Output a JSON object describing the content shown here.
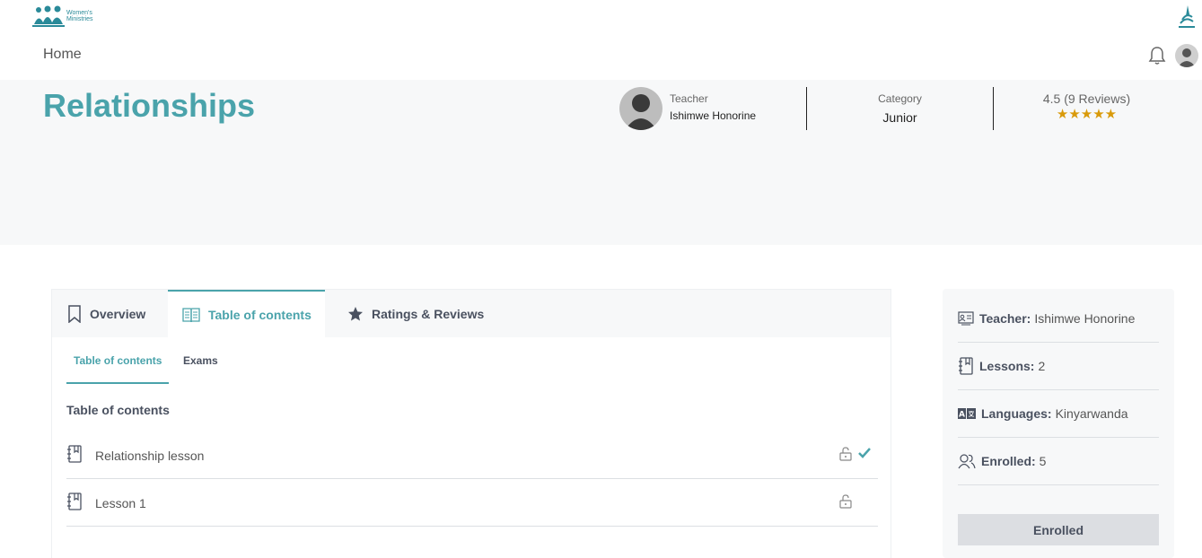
{
  "header": {
    "logo_text_line1": "Women's",
    "logo_text_line2": "Ministries",
    "home_label": "Home"
  },
  "course": {
    "title": "Relationships",
    "teacher_label": "Teacher",
    "teacher_name": "Ishimwe Honorine",
    "category_label": "Category",
    "category_value": "Junior",
    "rating_text": "4.5 (9 Reviews)",
    "stars": "★★★★★",
    "star_color": "#d99a0a"
  },
  "tabs": [
    {
      "label": "Overview",
      "icon": "bookmark-icon"
    },
    {
      "label": "Table of contents",
      "icon": "open-book-icon",
      "active": true
    },
    {
      "label": "Ratings & Reviews",
      "icon": "star-icon"
    }
  ],
  "subtabs": [
    {
      "label": "Table of contents",
      "active": true
    },
    {
      "label": "Exams"
    }
  ],
  "toc": {
    "heading": "Table of contents",
    "lessons": [
      {
        "title": "Relationship lesson",
        "locked_icon": "unlock-icon",
        "completed": true
      },
      {
        "title": "Lesson 1",
        "locked_icon": "unlock-icon",
        "completed": false
      }
    ]
  },
  "sidebar": {
    "teacher_label": "Teacher:",
    "teacher_value": "Ishimwe Honorine",
    "lessons_label": "Lessons:",
    "lessons_value": "2",
    "languages_label": "Languages:",
    "languages_value": "Kinyarwanda",
    "enrolled_label": "Enrolled:",
    "enrolled_value": "5",
    "button_label": "Enrolled"
  },
  "colors": {
    "accent": "#4aa3ab",
    "hero_bg": "#f7f8f9"
  }
}
